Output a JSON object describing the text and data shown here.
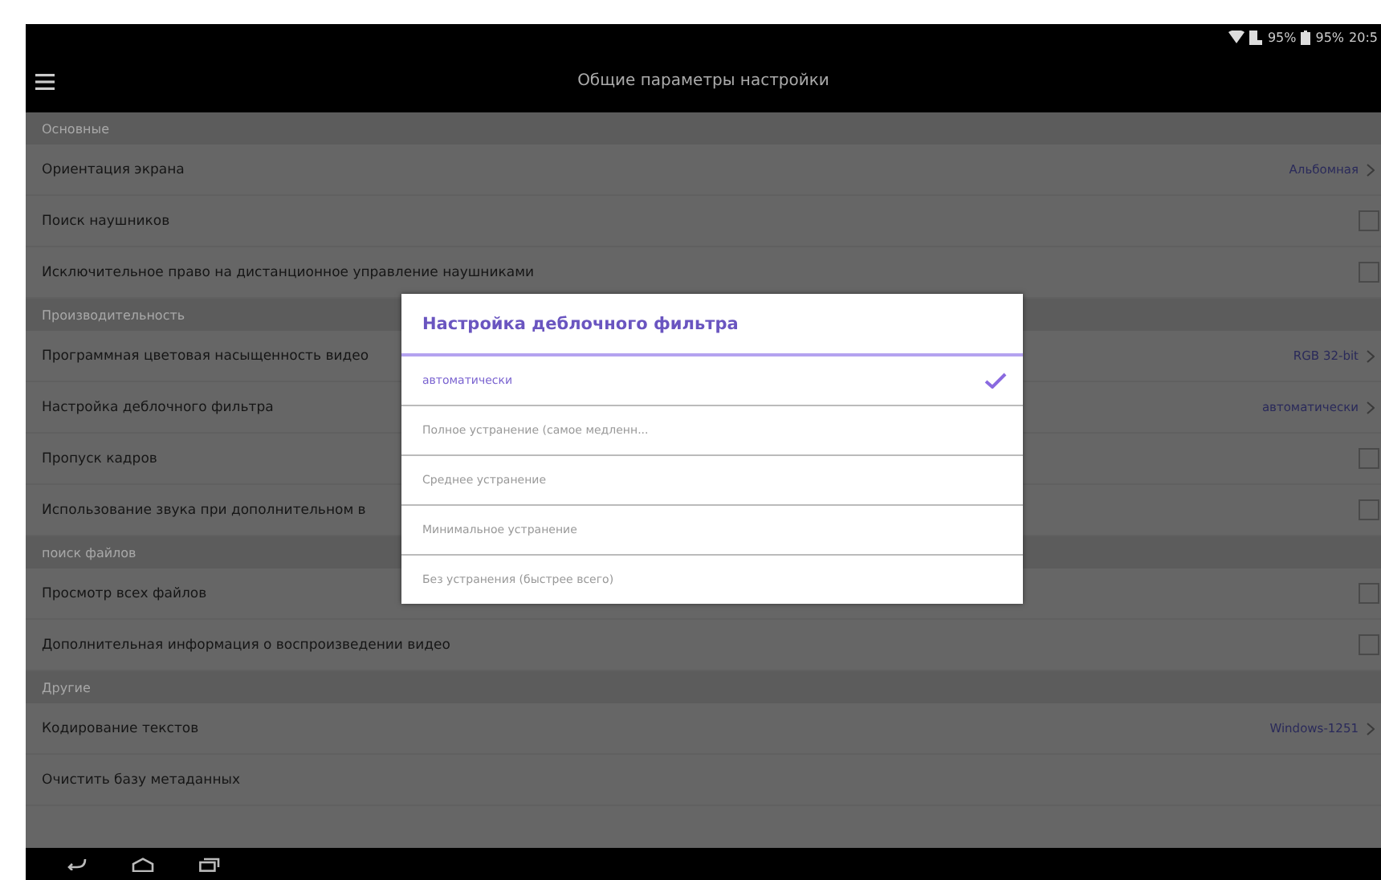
{
  "status_bar": {
    "wifi_battery_text": "95%",
    "battery_text": "95%",
    "time": "20:5"
  },
  "toolbar": {
    "title": "Общие параметры настройки"
  },
  "settings": [
    {
      "kind": "header",
      "label": "Основные"
    },
    {
      "kind": "value",
      "label": "Ориентация экрана",
      "value": "Альбомная"
    },
    {
      "kind": "checkbox",
      "label": "Поиск наушников",
      "checked": false
    },
    {
      "kind": "checkbox",
      "label": "Исключительное право на дистанционное управление наушниками",
      "checked": false
    },
    {
      "kind": "header",
      "label": "Производительность"
    },
    {
      "kind": "value",
      "label": "Программная цветовая насыщенность видео",
      "value": "RGB 32-bit"
    },
    {
      "kind": "value",
      "label": "Настройка деблочного фильтра",
      "value": "автоматически"
    },
    {
      "kind": "checkbox",
      "label": "Пропуск кадров",
      "checked": false
    },
    {
      "kind": "checkbox",
      "label": "Использование звука при дополнительном в",
      "checked": false
    },
    {
      "kind": "header",
      "label": "поиск файлов"
    },
    {
      "kind": "checkbox",
      "label": "Просмотр всех файлов",
      "checked": false
    },
    {
      "kind": "checkbox",
      "label": "Дополнительная информация о воспроизведении видео",
      "checked": false
    },
    {
      "kind": "header",
      "label": "Другие"
    },
    {
      "kind": "value",
      "label": "Кодирование текстов",
      "value": "Windows-1251"
    },
    {
      "kind": "plain",
      "label": "Очистить базу метаданных"
    }
  ],
  "dialog": {
    "title": "Настройка деблочного фильтра",
    "options": [
      {
        "label": "автоматически",
        "selected": true
      },
      {
        "label": "Полное устранение (самое медленн...",
        "selected": false
      },
      {
        "label": "Среднее устранение",
        "selected": false
      },
      {
        "label": "Минимальное устранение",
        "selected": false
      },
      {
        "label": "Без устранения (быстрее всего)",
        "selected": false
      }
    ]
  }
}
